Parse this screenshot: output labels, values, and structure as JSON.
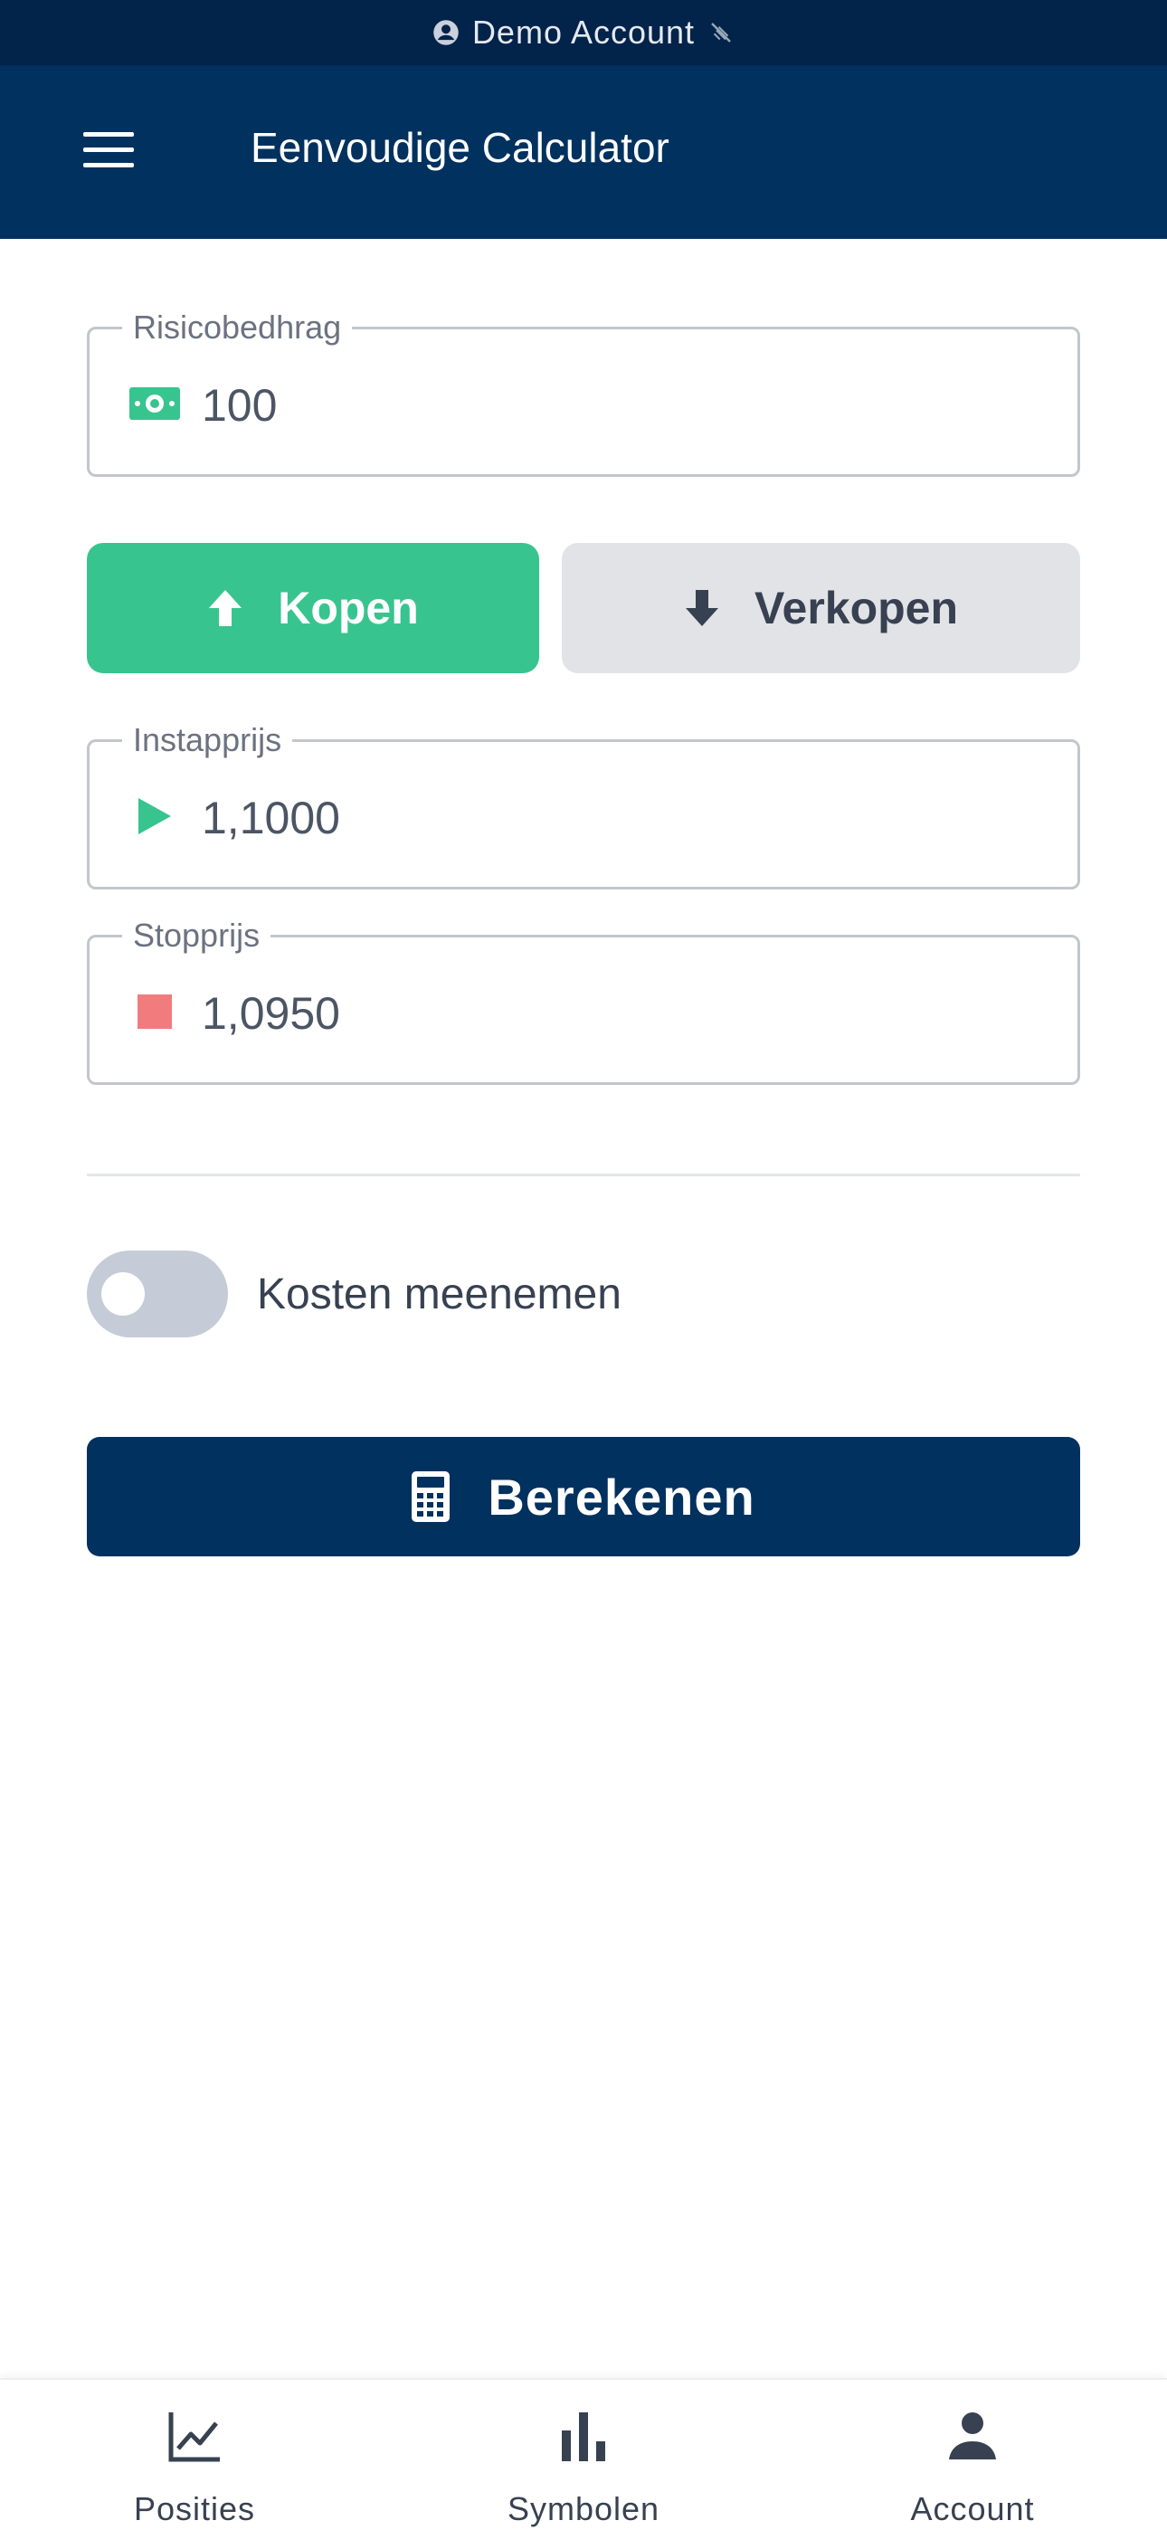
{
  "status_bar": {
    "account_label": "Demo Account"
  },
  "app_bar": {
    "title": "Eenvoudige Calculator"
  },
  "form": {
    "risk": {
      "label": "Risicobedhrag",
      "value": "100"
    },
    "buy_label": "Kopen",
    "sell_label": "Verkopen",
    "entry": {
      "label": "Instapprijs",
      "value": "1,1000"
    },
    "stop": {
      "label": "Stopprijs",
      "value": "1,0950"
    },
    "costs_toggle": {
      "label": "Kosten meenemen",
      "on": false
    },
    "calculate_label": "Berekenen"
  },
  "bottom_nav": {
    "items": [
      {
        "label": "Posities",
        "icon": "chart-line-icon"
      },
      {
        "label": "Symbolen",
        "icon": "bar-chart-icon"
      },
      {
        "label": "Account",
        "icon": "person-icon"
      }
    ]
  },
  "colors": {
    "primary": "#01315f",
    "status_bar": "#02234a",
    "buy": "#38c48f",
    "sell": "#e2e3e6",
    "stop_marker": "#f07c7e"
  }
}
